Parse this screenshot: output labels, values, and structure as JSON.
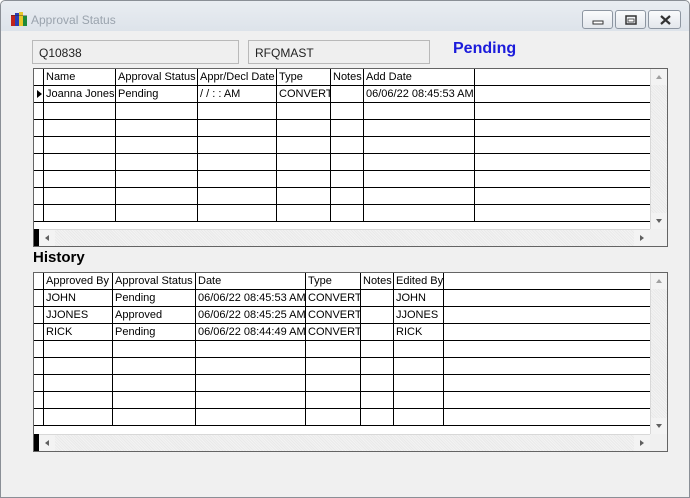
{
  "window": {
    "title": "Approval Status",
    "icon": "app-blocks-icon"
  },
  "header": {
    "quote_number": "Q10838",
    "table_name": "RFQMAST",
    "status": "Pending",
    "status_color": "#1b1bdb"
  },
  "approval_grid": {
    "columns": [
      "Name",
      "Approval Status",
      "Appr/Decl Date",
      "Type",
      "Notes",
      "Add Date"
    ],
    "rows": [
      [
        "Joanna Jones",
        "Pending",
        " /  /      :  :   AM",
        "CONVERT",
        "",
        "06/06/22 08:45:53 AM"
      ]
    ],
    "empty_rows": 7
  },
  "history": {
    "title": "History",
    "columns": [
      "Approved By",
      "Approval Status",
      "Date",
      "Type",
      "Notes",
      "Edited By"
    ],
    "rows": [
      [
        "JOHN",
        "Pending",
        "06/06/22 08:45:53 AM",
        "CONVERT",
        "",
        "JOHN"
      ],
      [
        "JJONES",
        "Approved",
        "06/06/22 08:45:25 AM",
        "CONVERT",
        "",
        "JJONES"
      ],
      [
        "RICK",
        "Pending",
        "06/06/22 08:44:49 AM",
        "CONVERT",
        "",
        "RICK"
      ]
    ],
    "empty_rows": 5
  }
}
